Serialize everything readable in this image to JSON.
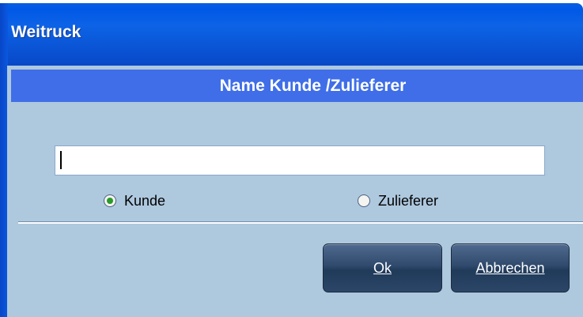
{
  "window": {
    "title": "Weitruck"
  },
  "header": {
    "title": "Name Kunde /Zulieferer"
  },
  "name_input": {
    "value": "",
    "placeholder": ""
  },
  "options": {
    "kunde_label": "Kunde",
    "zulieferer_label": "Zulieferer",
    "selected": "Kunde"
  },
  "buttons": {
    "ok_label": "Ok",
    "cancel_label": "Abbrechen"
  },
  "colors": {
    "titlebar": "#0a58e0",
    "header_band": "#3f6ee8",
    "client_bg": "#aec8de",
    "button_bg": "#2f4a6c",
    "radio_selected": "#2a9a2a"
  }
}
